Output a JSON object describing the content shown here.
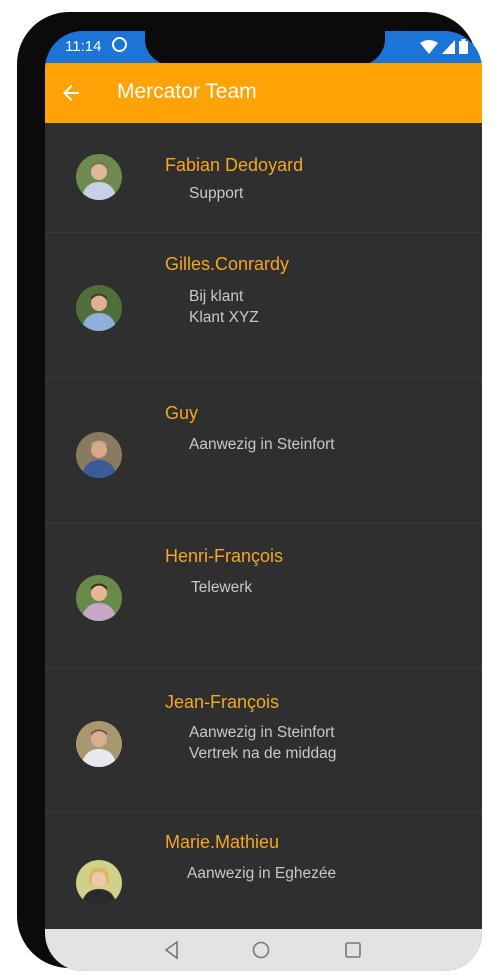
{
  "status_bar": {
    "time": "11:14"
  },
  "app_bar": {
    "title": "Mercator Team"
  },
  "team": [
    {
      "name": "Fabian Dedoyard",
      "lines": [
        "Support"
      ]
    },
    {
      "name": "Gilles.Conrardy",
      "lines": [
        "Bij klant",
        "Klant XYZ"
      ]
    },
    {
      "name": "Guy",
      "lines": [
        "Aanwezig in Steinfort"
      ]
    },
    {
      "name": "Henri-François",
      "lines": [
        "Telewerk"
      ]
    },
    {
      "name": "Jean-François",
      "lines": [
        "Aanwezig in Steinfort",
        "Vertrek na de middag"
      ]
    },
    {
      "name": "Marie.Mathieu",
      "lines": [
        "Aanwezig in Eghezée"
      ]
    }
  ],
  "colors": {
    "accent": "#fda305",
    "name_text": "#f5a623",
    "status_bar": "#1b74d6",
    "background": "#2f2f2f"
  }
}
